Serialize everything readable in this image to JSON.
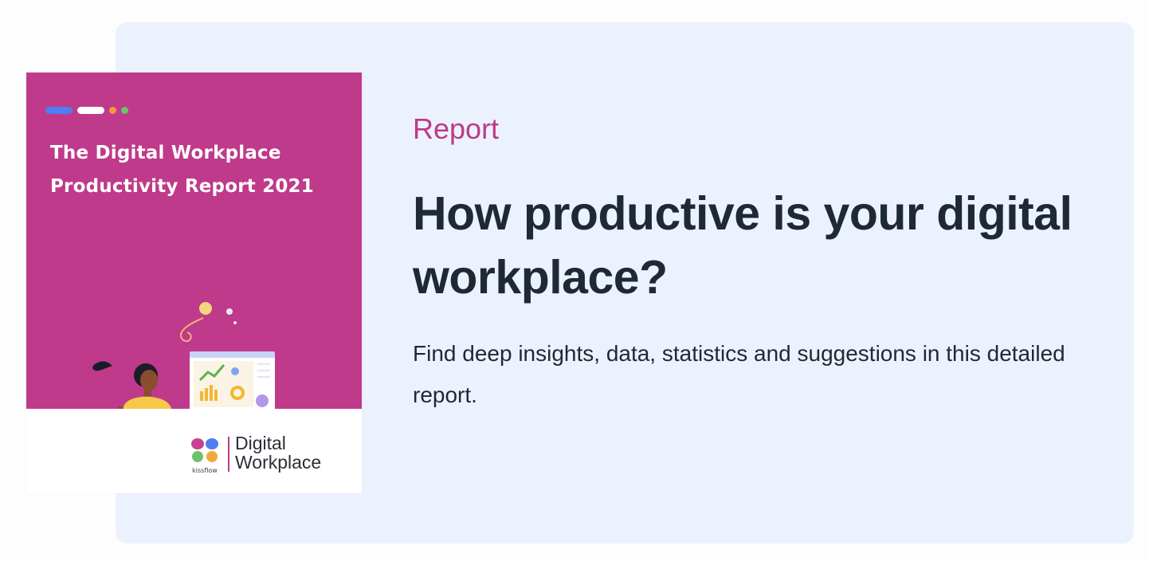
{
  "card": {
    "tag": "Report",
    "headline": "How productive is your digital workplace?",
    "description": "Find deep insights, data, statistics and suggestions in this detailed report."
  },
  "cover": {
    "title": "The Digital Workplace Productivity Report 2021",
    "brand_small": "kissflow",
    "brand_line1": "Digital",
    "brand_line2": "Workplace",
    "illustration": "woman-working-on-laptop-with-dashboard",
    "colors": {
      "background": "#bf3a8b",
      "accent_blue": "#4f7df3",
      "accent_orange": "#f29a3d",
      "accent_green": "#6cc36a"
    }
  },
  "colors": {
    "card_background": "#ecf2fd",
    "tag": "#bc3a88",
    "text": "#1f2933"
  }
}
